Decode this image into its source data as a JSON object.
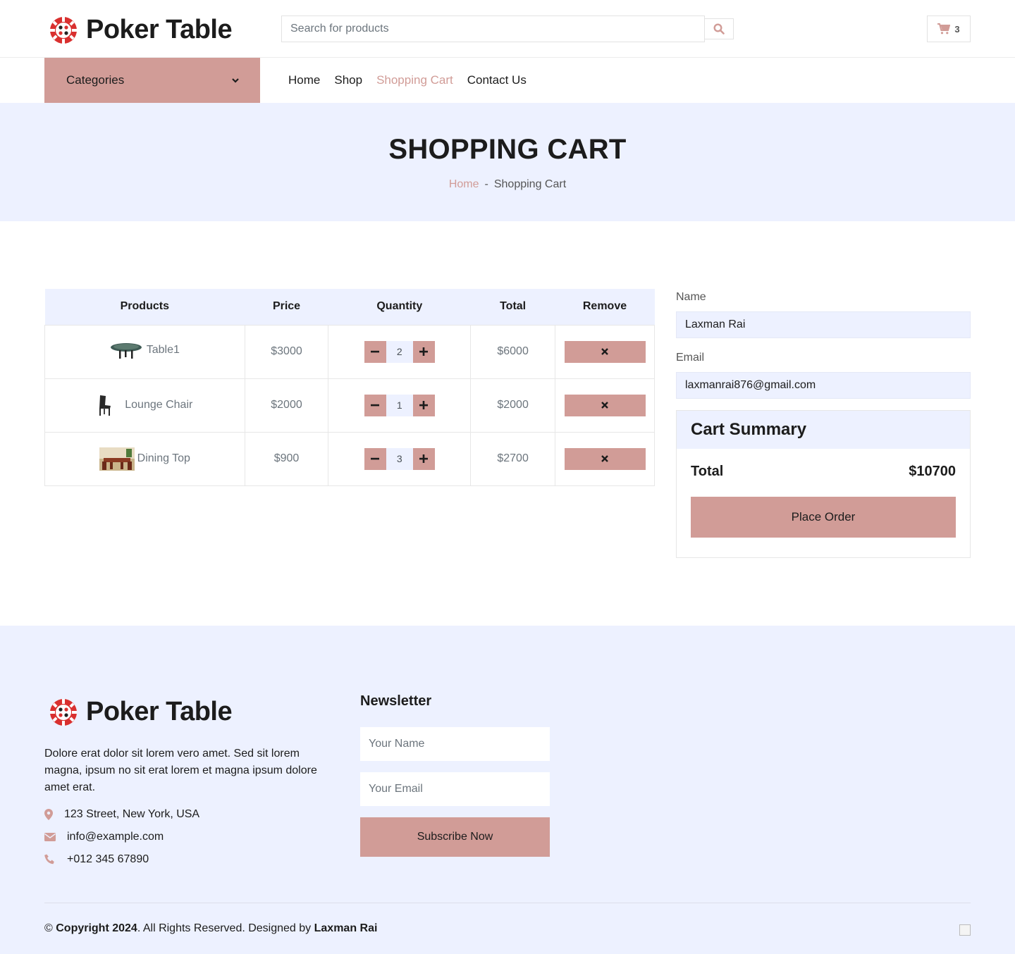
{
  "brand": {
    "name": "Poker Table"
  },
  "search": {
    "placeholder": "Search for products"
  },
  "cart": {
    "count": "3"
  },
  "categories": {
    "label": "Categories"
  },
  "nav": {
    "items": [
      {
        "label": "Home",
        "active": false
      },
      {
        "label": "Shop",
        "active": false
      },
      {
        "label": "Shopping Cart",
        "active": true
      },
      {
        "label": "Contact Us",
        "active": false
      }
    ]
  },
  "header": {
    "title": "SHOPPING CART",
    "breadcrumb_home": "Home",
    "breadcrumb_sep": "-",
    "breadcrumb_current": "Shopping Cart"
  },
  "table": {
    "headers": [
      "Products",
      "Price",
      "Quantity",
      "Total",
      "Remove"
    ],
    "rows": [
      {
        "product": "Table1",
        "price": "$3000",
        "qty": "2",
        "total": "$6000",
        "image": "poker-table-thumbnail"
      },
      {
        "product": "Lounge Chair",
        "price": "$2000",
        "qty": "1",
        "total": "$2000",
        "image": "chair-thumbnail"
      },
      {
        "product": "Dining Top",
        "price": "$900",
        "qty": "3",
        "total": "$2700",
        "image": "dining-table-thumbnail"
      }
    ]
  },
  "form": {
    "name_label": "Name",
    "name_value": "Laxman Rai",
    "email_label": "Email",
    "email_value": "laxmanrai876@gmail.com"
  },
  "summary": {
    "title": "Cart Summary",
    "total_label": "Total",
    "total_value": "$10700",
    "button": "Place Order"
  },
  "footer": {
    "brand": "Poker Table",
    "description": "Dolore erat dolor sit lorem vero amet. Sed sit lorem magna, ipsum no sit erat lorem et magna ipsum dolore amet erat.",
    "address": "123 Street, New York, USA",
    "email": "info@example.com",
    "phone": "+012 345 67890",
    "newsletter_title": "Newsletter",
    "newsletter_name_placeholder": "Your Name",
    "newsletter_email_placeholder": "Your Email",
    "subscribe": "Subscribe Now",
    "copyright_prefix": "© ",
    "copyright_bold": "Copyright 2024",
    "copyright_mid": ". All Rights Reserved. Designed by ",
    "designer": "Laxman Rai"
  },
  "colors": {
    "accent": "#d19c97",
    "light_bg": "#edf1ff",
    "text": "#1c1c1c",
    "muted": "#6c757d"
  },
  "icons": [
    "poker-chip-logo-icon",
    "search-icon",
    "shopping-cart-icon",
    "chevron-down-icon",
    "minus-icon",
    "plus-icon",
    "close-icon",
    "map-marker-icon",
    "envelope-icon",
    "phone-icon"
  ]
}
